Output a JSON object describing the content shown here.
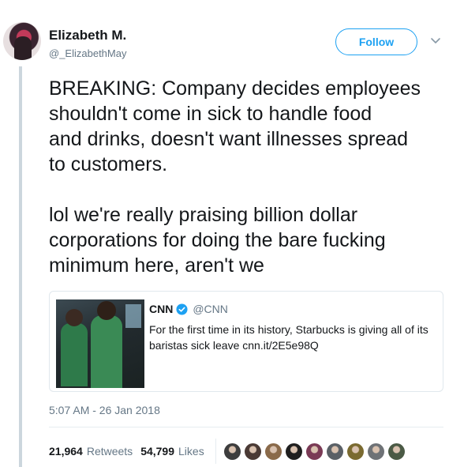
{
  "author": {
    "name": "Elizabeth M.",
    "handle": "@_ElizabethMay"
  },
  "follow_label": "Follow",
  "tweet": {
    "paragraph1": "BREAKING: Company decides employees\nshouldn't come in sick to handle food\nand drinks, doesn't want illnesses spread\nto customers.",
    "paragraph2": "lol we're really praising billion dollar\ncorporations for doing the bare fucking\nminimum here, aren't we"
  },
  "quoted": {
    "name": "CNN",
    "handle": "@CNN",
    "text": "For the first time in its history, Starbucks is giving all of its baristas sick leave cnn.it/2E5e98Q"
  },
  "timestamp": "5:07 AM - 26 Jan 2018",
  "stats": {
    "retweets_count": "21,964",
    "retweets_label": "Retweets",
    "likes_count": "54,799",
    "likes_label": "Likes"
  },
  "likers": [
    {
      "color": "#3d3d3d"
    },
    {
      "color": "#4a3a35"
    },
    {
      "color": "#8a6a4a"
    },
    {
      "color": "#1f1f1f"
    },
    {
      "color": "#7a3a55"
    },
    {
      "color": "#5a6066"
    },
    {
      "color": "#7a6a30"
    },
    {
      "color": "#6e7276"
    },
    {
      "color": "#4b5a45"
    }
  ],
  "colors": {
    "accent": "#1da1f2",
    "secondary_text": "#657786"
  }
}
